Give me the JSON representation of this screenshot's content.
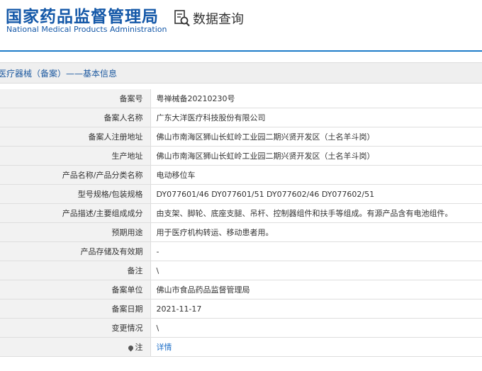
{
  "header": {
    "logo_cn": "国家药品监督管理局",
    "logo_en": "National Medical Products Administration",
    "query_title": "数据查询"
  },
  "section": {
    "title": "医疗器械（备案）——基本信息"
  },
  "rows": [
    {
      "label": "备案号",
      "value": "粤禅械备20210230号"
    },
    {
      "label": "备案人名称",
      "value": "广东大洋医疗科技股份有限公司"
    },
    {
      "label": "备案人注册地址",
      "value": "佛山市南海区狮山长虹岭工业园二期兴贤开发区（土名羊斗岗）"
    },
    {
      "label": "生产地址",
      "value": "佛山市南海区狮山长虹岭工业园二期兴贤开发区（土名羊斗岗）"
    },
    {
      "label": "产品名称/产品分类名称",
      "value": "电动移位车"
    },
    {
      "label": "型号规格/包装规格",
      "value": "DY077601/46 DY077601/51 DY077602/46 DY077602/51"
    },
    {
      "label": "产品描述/主要组成成分",
      "value": "由支架、脚轮、底座支腿、吊杆、控制器组件和扶手等组成。有源产品含有电池组件。"
    },
    {
      "label": "预期用途",
      "value": "用于医疗机构转运、移动患者用。"
    },
    {
      "label": "产品存储及有效期",
      "value": "-"
    },
    {
      "label": "备注",
      "value": "\\"
    },
    {
      "label": "备案单位",
      "value": "佛山市食品药品监督管理局"
    },
    {
      "label": "备案日期",
      "value": "2021-11-17"
    },
    {
      "label": "变更情况",
      "value": "\\"
    },
    {
      "label": "注",
      "value": "详情"
    }
  ],
  "icons": {
    "query": "search-document-icon",
    "note": "pin-icon"
  },
  "colors": {
    "brand_blue": "#1458a8",
    "accent_line": "#1e7cc8",
    "link": "#1e6fc8"
  }
}
